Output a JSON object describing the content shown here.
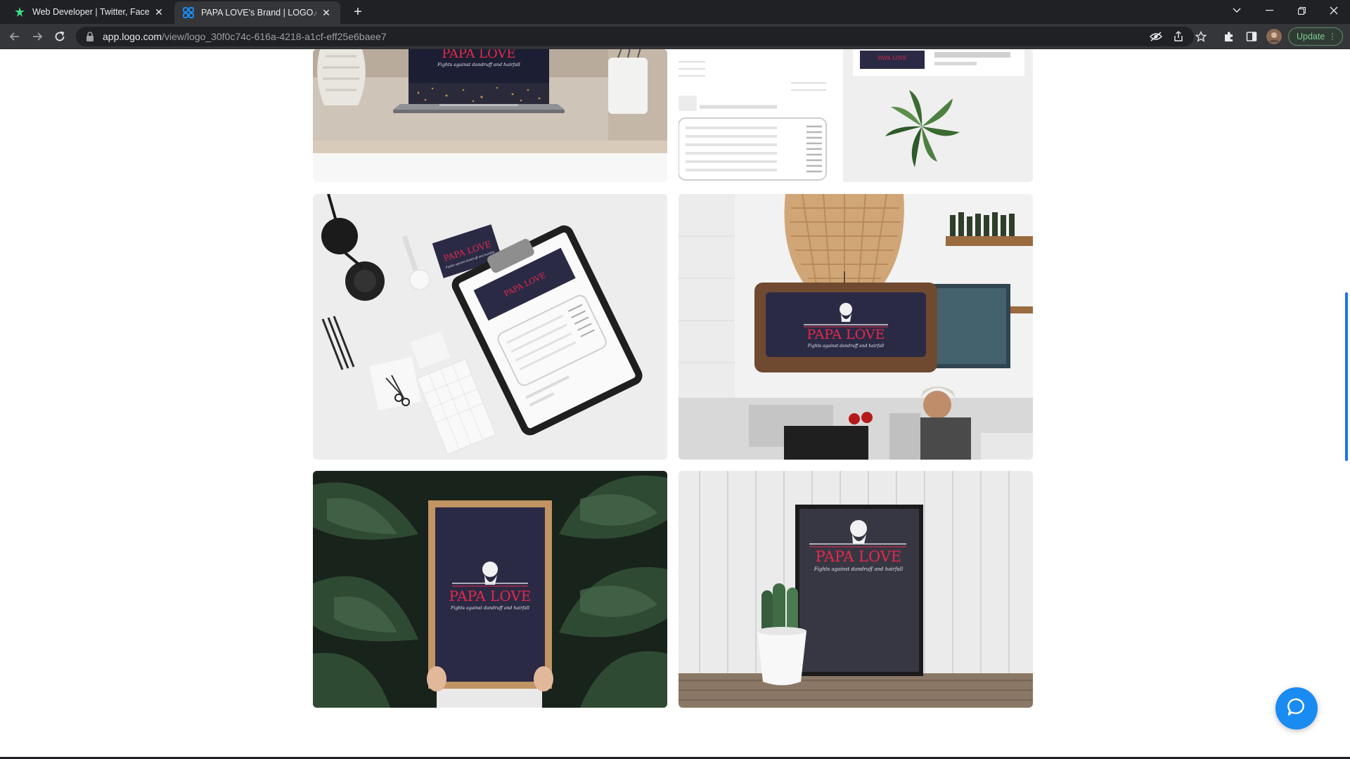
{
  "browser": {
    "tabs": [
      {
        "title": "Web Developer | Twitter, Faceboo",
        "icon": "puzzle-star-icon",
        "active": false
      },
      {
        "title": "PAPA LOVE's Brand | LOGO.com",
        "icon": "logo-com-icon",
        "active": true
      }
    ],
    "new_tab_symbol": "+",
    "url_host": "app.logo.com",
    "url_path": "/view/logo_30f0c74c-616a-4218-a1cf-eff25e6baee7",
    "update_label": "Update",
    "colors": {
      "tab_bar": "#202124",
      "toolbar": "#35363a",
      "update_accent": "#81c995"
    }
  },
  "brand": {
    "name": "PAPA LOVE",
    "tagline": "Fights against dandruff and hairfall",
    "colors": {
      "navy": "#2b2a45",
      "red": "#e5294b"
    }
  },
  "mockups": [
    {
      "id": "laptop",
      "label": "Laptop desk mockup"
    },
    {
      "id": "webpage",
      "label": "Website and plant mockup"
    },
    {
      "id": "stationery",
      "label": "Stationery clipboard mockup"
    },
    {
      "id": "cafe-sign",
      "label": "Cafe hanging sign mockup"
    },
    {
      "id": "poster-plants",
      "label": "Poster held in plants mockup"
    },
    {
      "id": "poster-cactus",
      "label": "Framed poster with cactus mockup"
    }
  ],
  "chat": {
    "icon": "chat-bubble-icon"
  }
}
